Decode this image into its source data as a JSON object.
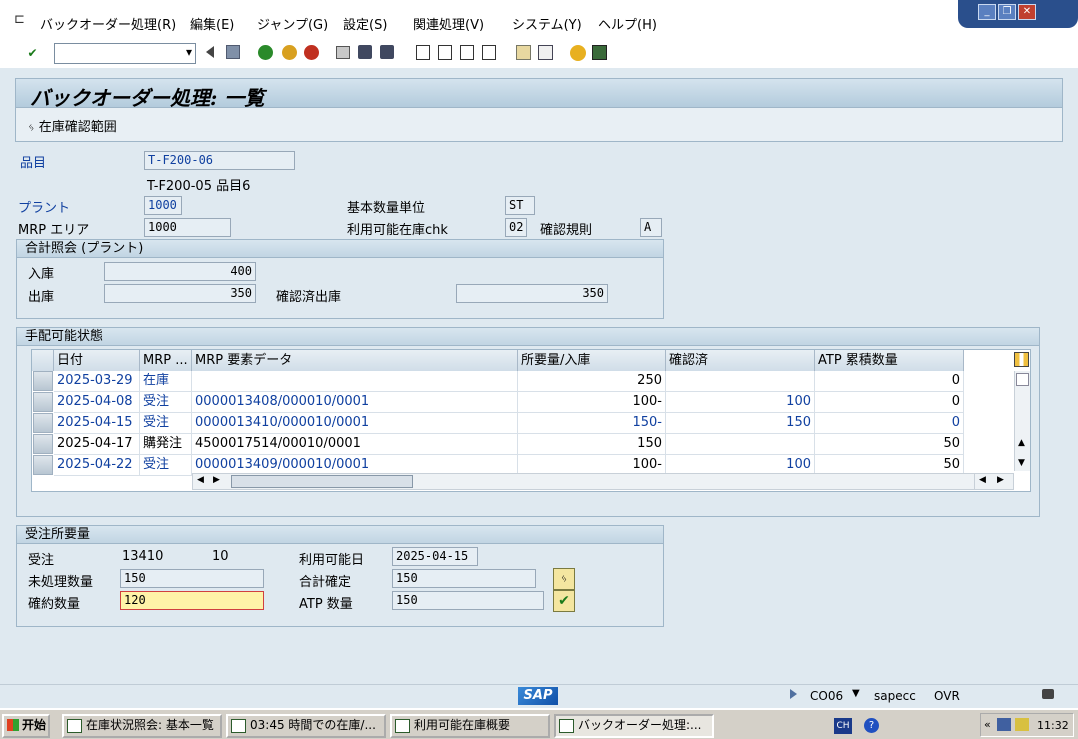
{
  "menu": {
    "items": [
      "バックオーダー処理(R)",
      "編集(E)",
      "ジャンプ(G)",
      "設定(S)",
      "関連処理(V)",
      "システム(Y)",
      "ヘルプ(H)"
    ]
  },
  "window_controls": {
    "minimize": "_",
    "restore": "❐",
    "close": "✕"
  },
  "toolbar": {
    "enter_icon": "✔",
    "command_field_value": "",
    "dropdown_icon": "▾",
    "icons": [
      "back-icon",
      "save-icon",
      "exit-icon",
      "up-icon",
      "cancel-icon",
      "print-icon",
      "find-icon",
      "find-next-icon",
      "first-page-icon",
      "prev-page-icon",
      "next-page-icon",
      "last-page-icon",
      "new-session-icon",
      "shortcut-icon",
      "help-icon",
      "layout-icon"
    ]
  },
  "page": {
    "title": "バックオーダー処理: 一覧",
    "app_button": "在庫確認範囲"
  },
  "header": {
    "material_label": "品目",
    "material_value": "T-F200-06",
    "material_desc": "T-F200-05 品目6",
    "plant_label": "プラント",
    "plant_value": "1000",
    "mrp_area_label": "MRP エリア",
    "mrp_area_value": "1000",
    "base_unit_label": "基本数量単位",
    "base_unit_value": "ST",
    "avail_check_label": "利用可能在庫chk",
    "avail_check_value": "02",
    "check_rule_label": "確認規則",
    "check_rule_value": "A"
  },
  "totals": {
    "title": "合計照会 (プラント)",
    "receipts_label": "入庫",
    "receipts_value": "400",
    "issues_label": "出庫",
    "issues_value": "350",
    "confirmed_issues_label": "確認済出庫",
    "confirmed_issues_value": "350"
  },
  "availability": {
    "title": "手配可能状態",
    "columns": [
      "日付",
      "MRP ...",
      "MRP 要素データ",
      "所要量/入庫",
      "確認済",
      "ATP 累積数量"
    ],
    "rows": [
      {
        "date": "2025-03-29",
        "mrp": "在庫",
        "element": "",
        "qty": "250",
        "confirmed": "",
        "atp": "0",
        "blue": true
      },
      {
        "date": "2025-04-08",
        "mrp": "受注",
        "element": "0000013408/000010/0001",
        "qty": "100-",
        "confirmed": "100",
        "atp": "0",
        "blue": true
      },
      {
        "date": "2025-04-15",
        "mrp": "受注",
        "element": "0000013410/000010/0001",
        "qty": "150-",
        "confirmed": "150",
        "atp": "0",
        "blue": true
      },
      {
        "date": "2025-04-17",
        "mrp": "購発注",
        "element": "4500017514/00010/0001",
        "qty": "150",
        "confirmed": "",
        "atp": "50",
        "blue": false
      },
      {
        "date": "2025-04-22",
        "mrp": "受注",
        "element": "0000013409/000010/0001",
        "qty": "100-",
        "confirmed": "100",
        "atp": "50",
        "blue": true
      }
    ]
  },
  "sales_req": {
    "title": "受注所要量",
    "order_label": "受注",
    "order_no": "13410",
    "item_no": "10",
    "avail_date_label": "利用可能日",
    "avail_date_value": "2025-04-15",
    "open_qty_label": "未処理数量",
    "open_qty_value": "150",
    "total_conf_label": "合計確定",
    "total_conf_value": "150",
    "committed_label": "確約数量",
    "committed_value": "120",
    "atp_label": "ATP 数量",
    "atp_value": "150"
  },
  "status": {
    "logo": "SAP",
    "transaction": "CO06",
    "server": "sapecc",
    "mode": "OVR"
  },
  "taskbar": {
    "start": "开始",
    "tasks": [
      "在庫状況照会: 基本一覧",
      "03:45 時間での在庫/...",
      "利用可能在庫概要",
      "バックオーダー処理:..."
    ],
    "lang": "CH",
    "time": "11:32"
  }
}
